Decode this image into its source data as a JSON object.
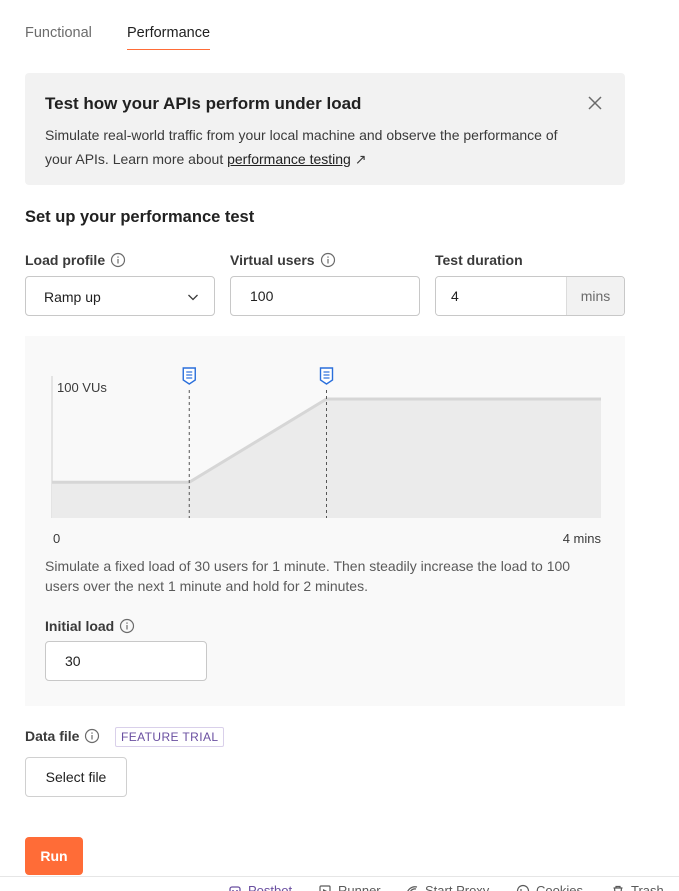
{
  "tabs": [
    {
      "label": "Functional",
      "active": false
    },
    {
      "label": "Performance",
      "active": true
    }
  ],
  "accent_color": "#ff6c37",
  "banner": {
    "title": "Test how your APIs perform under load",
    "text": "Simulate real-world traffic from your local machine and observe the performance of your APIs. Learn more about ",
    "link_label": "performance testing",
    "link_arrow": "↗",
    "close_icon": "close-icon"
  },
  "setup": {
    "title": "Set up your performance test",
    "load_profile": {
      "label": "Load profile",
      "value": "Ramp up"
    },
    "virtual_users": {
      "label": "Virtual users",
      "value": "100"
    },
    "test_duration": {
      "label": "Test duration",
      "value": "4",
      "unit": "mins"
    }
  },
  "chart_data": {
    "type": "area",
    "y_label": "100 VUs",
    "x_start_label": "0",
    "x_end_label": "4 mins",
    "xlim": [
      0,
      4
    ],
    "ylim": [
      0,
      100
    ],
    "points": [
      {
        "x": 0,
        "y": 30
      },
      {
        "x": 1,
        "y": 30
      },
      {
        "x": 2,
        "y": 100
      },
      {
        "x": 4,
        "y": 100
      }
    ],
    "markers_x": [
      1,
      2
    ],
    "marker_icon": "note-marker-icon"
  },
  "chart_description": "Simulate a fixed load of 30 users for 1 minute. Then steadily increase the load to 100 users over the next 1 minute and hold for 2 minutes.",
  "initial_load": {
    "label": "Initial load",
    "value": "30"
  },
  "data_file": {
    "label": "Data file",
    "badge": "FEATURE TRIAL",
    "button_label": "Select file"
  },
  "run_button": {
    "label": "Run"
  },
  "statusbar": {
    "items": [
      {
        "label": "Postbot",
        "icon": "postbot-icon"
      },
      {
        "label": "Runner",
        "icon": "runner-icon"
      },
      {
        "label": "Start Proxy",
        "icon": "proxy-icon"
      },
      {
        "label": "Cookies",
        "icon": "cookie-icon"
      },
      {
        "label": "Trash",
        "icon": "trash-icon"
      }
    ]
  }
}
